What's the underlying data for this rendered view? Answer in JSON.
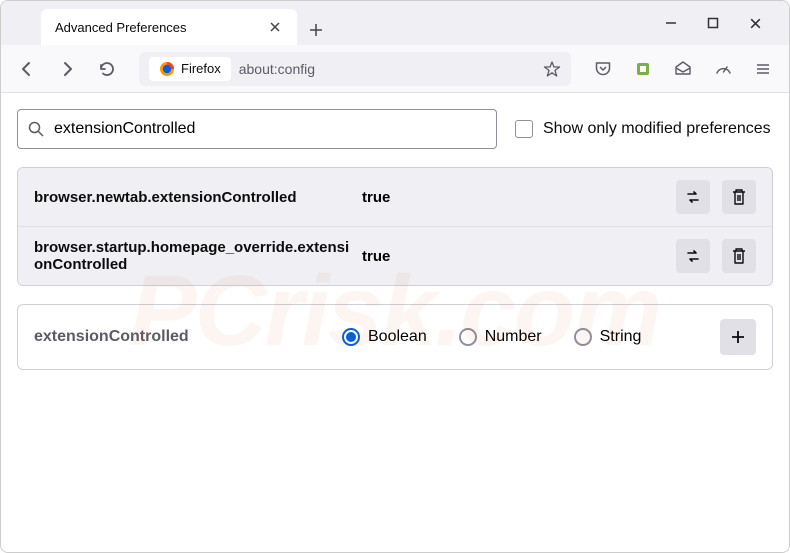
{
  "window": {
    "tab_title": "Advanced Preferences"
  },
  "address_bar": {
    "identity_label": "Firefox",
    "url": "about:config"
  },
  "content": {
    "search_value": "extensionControlled",
    "checkbox_label": "Show only modified preferences",
    "prefs": [
      {
        "name": "browser.newtab.extensionControlled",
        "value": "true"
      },
      {
        "name": "browser.startup.homepage_override.extensionControlled",
        "value": "true"
      }
    ],
    "new_pref": {
      "name": "extensionControlled",
      "types": [
        "Boolean",
        "Number",
        "String"
      ],
      "selected_index": 0
    }
  },
  "watermark": "PCrisk.com"
}
